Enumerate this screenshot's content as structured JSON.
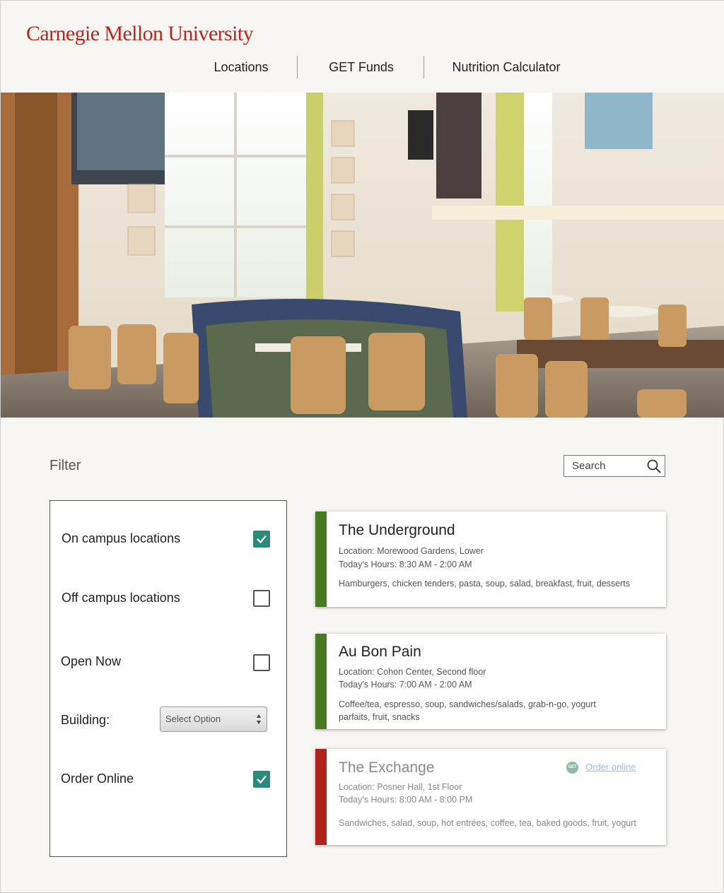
{
  "header": {
    "logo_text": "Carnegie Mellon University",
    "nav": [
      "Locations",
      "GET Funds",
      "Nutrition Calculator"
    ]
  },
  "filter": {
    "title": "Filter",
    "search_placeholder": "Search",
    "options": [
      {
        "label": "On campus locations",
        "checked": true
      },
      {
        "label": "Off campus locations",
        "checked": false
      },
      {
        "label": "Open Now",
        "checked": false
      },
      {
        "label": "Order Online",
        "checked": true
      }
    ],
    "building_label": "Building:",
    "building_value": "Select Option"
  },
  "locations": [
    {
      "name": "The Underground",
      "location": "Location: Morewood Gardens, Lower",
      "hours": "Today's Hours: 8:30 AM - 2:00 AM",
      "description": "Hamburgers, chicken tenders, pasta, soup, salad, breakfast, fruit, desserts",
      "color": "#4a7a1f"
    },
    {
      "name": "Au Bon Pain",
      "location": "Location: Cohon Center, Second floor",
      "hours": "Today's Hours: 7:00 AM - 2:00 AM",
      "description": "Coffee/tea, espresso, soup, sandwiches/salads, grab-n-go, yogurt parfaits, fruit, snacks",
      "color": "#4a7a1f"
    },
    {
      "name": "The Exchange",
      "location": "Location: Posner Hall, 1st Floor",
      "hours": "Today's Hours: 8:00 AM - 8:00 PM",
      "description": "Sandwiches, salad, soup, hot entrées, coffee, tea, baked goods, fruit, yogurt",
      "color": "#b0221c",
      "badge": "GET",
      "order_link": "Order online"
    }
  ],
  "colors": {
    "brand": "#b5281e",
    "checkbox": "#2e8b7a",
    "open_bar": "#4a7a1f",
    "closed_bar": "#b0221c"
  }
}
